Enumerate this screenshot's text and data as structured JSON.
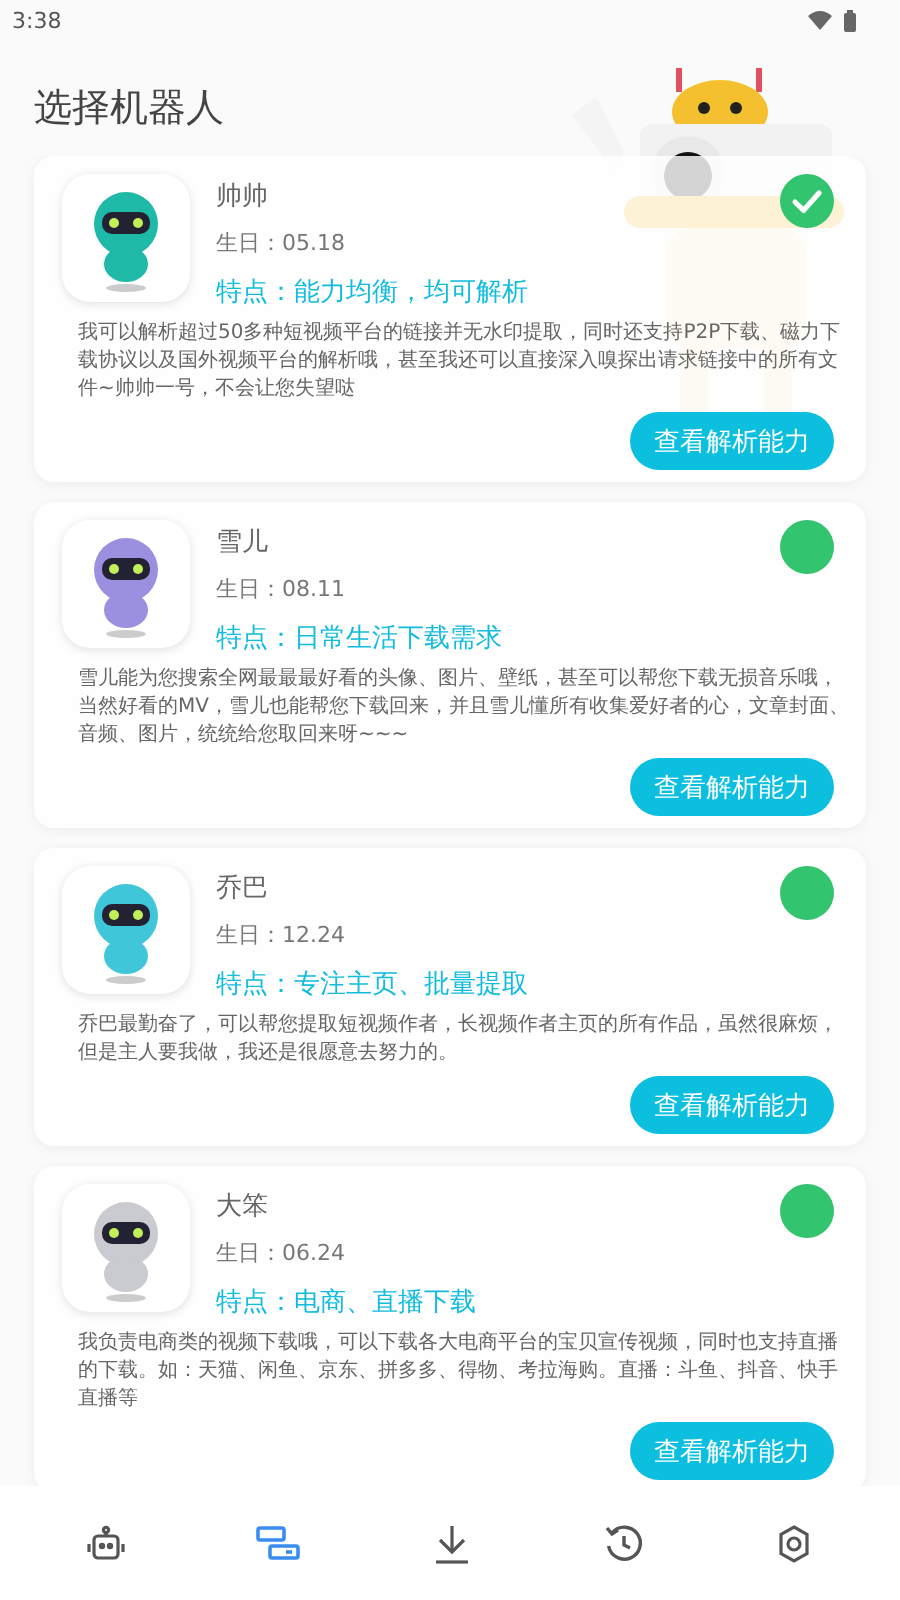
{
  "status_bar": {
    "time": "3:38"
  },
  "title": "选择机器人",
  "robots": [
    {
      "name": "帅帅",
      "birthday": "生日：05.18",
      "feature": "特点：能力均衡，均可解析",
      "description": "我可以解析超过50多种短视频平台的链接并无水印提取，同时还支持P2P下载、磁力下载协议以及国外视频平台的解析哦，甚至我还可以直接深入嗅探出请求链接中的所有文件~帅帅一号，不会让您失望哒",
      "button": "查看解析能力",
      "selected": true,
      "color": "#1fb9a8"
    },
    {
      "name": "雪儿",
      "birthday": "生日：08.11",
      "feature": "特点：日常生活下载需求",
      "description": "雪儿能为您搜索全网最最最好看的头像、图片、壁纸，甚至可以帮您下载无损音乐哦，当然好看的MV，雪儿也能帮您下载回来，并且雪儿懂所有收集爱好者的心，文章封面、音频、图片，统统给您取回来呀~~~",
      "button": "查看解析能力",
      "selected": false,
      "color": "#9b8fe0"
    },
    {
      "name": "乔巴",
      "birthday": "生日：12.24",
      "feature": "特点：专注主页、批量提取",
      "description": "乔巴最勤奋了，可以帮您提取短视频作者，长视频作者主页的所有作品，虽然很麻烦，但是主人要我做，我还是很愿意去努力的。",
      "button": "查看解析能力",
      "selected": false,
      "color": "#3fc6d8"
    },
    {
      "name": "大笨",
      "birthday": "生日：06.24",
      "feature": "特点：电商、直播下载",
      "description": "我负责电商类的视频下载哦，可以下载各大电商平台的宝贝宣传视频，同时也支持直播的下载。如：天猫、闲鱼、京东、拼多多、得物、考拉海购。直播：斗鱼、抖音、快手直播等",
      "button": "查看解析能力",
      "selected": false,
      "color": "#c9cbd0"
    }
  ],
  "nav": [
    {
      "kind": "robot",
      "selected": false
    },
    {
      "kind": "tasks",
      "selected": true
    },
    {
      "kind": "download",
      "selected": false
    },
    {
      "kind": "history",
      "selected": false
    },
    {
      "kind": "settings",
      "selected": false
    }
  ]
}
